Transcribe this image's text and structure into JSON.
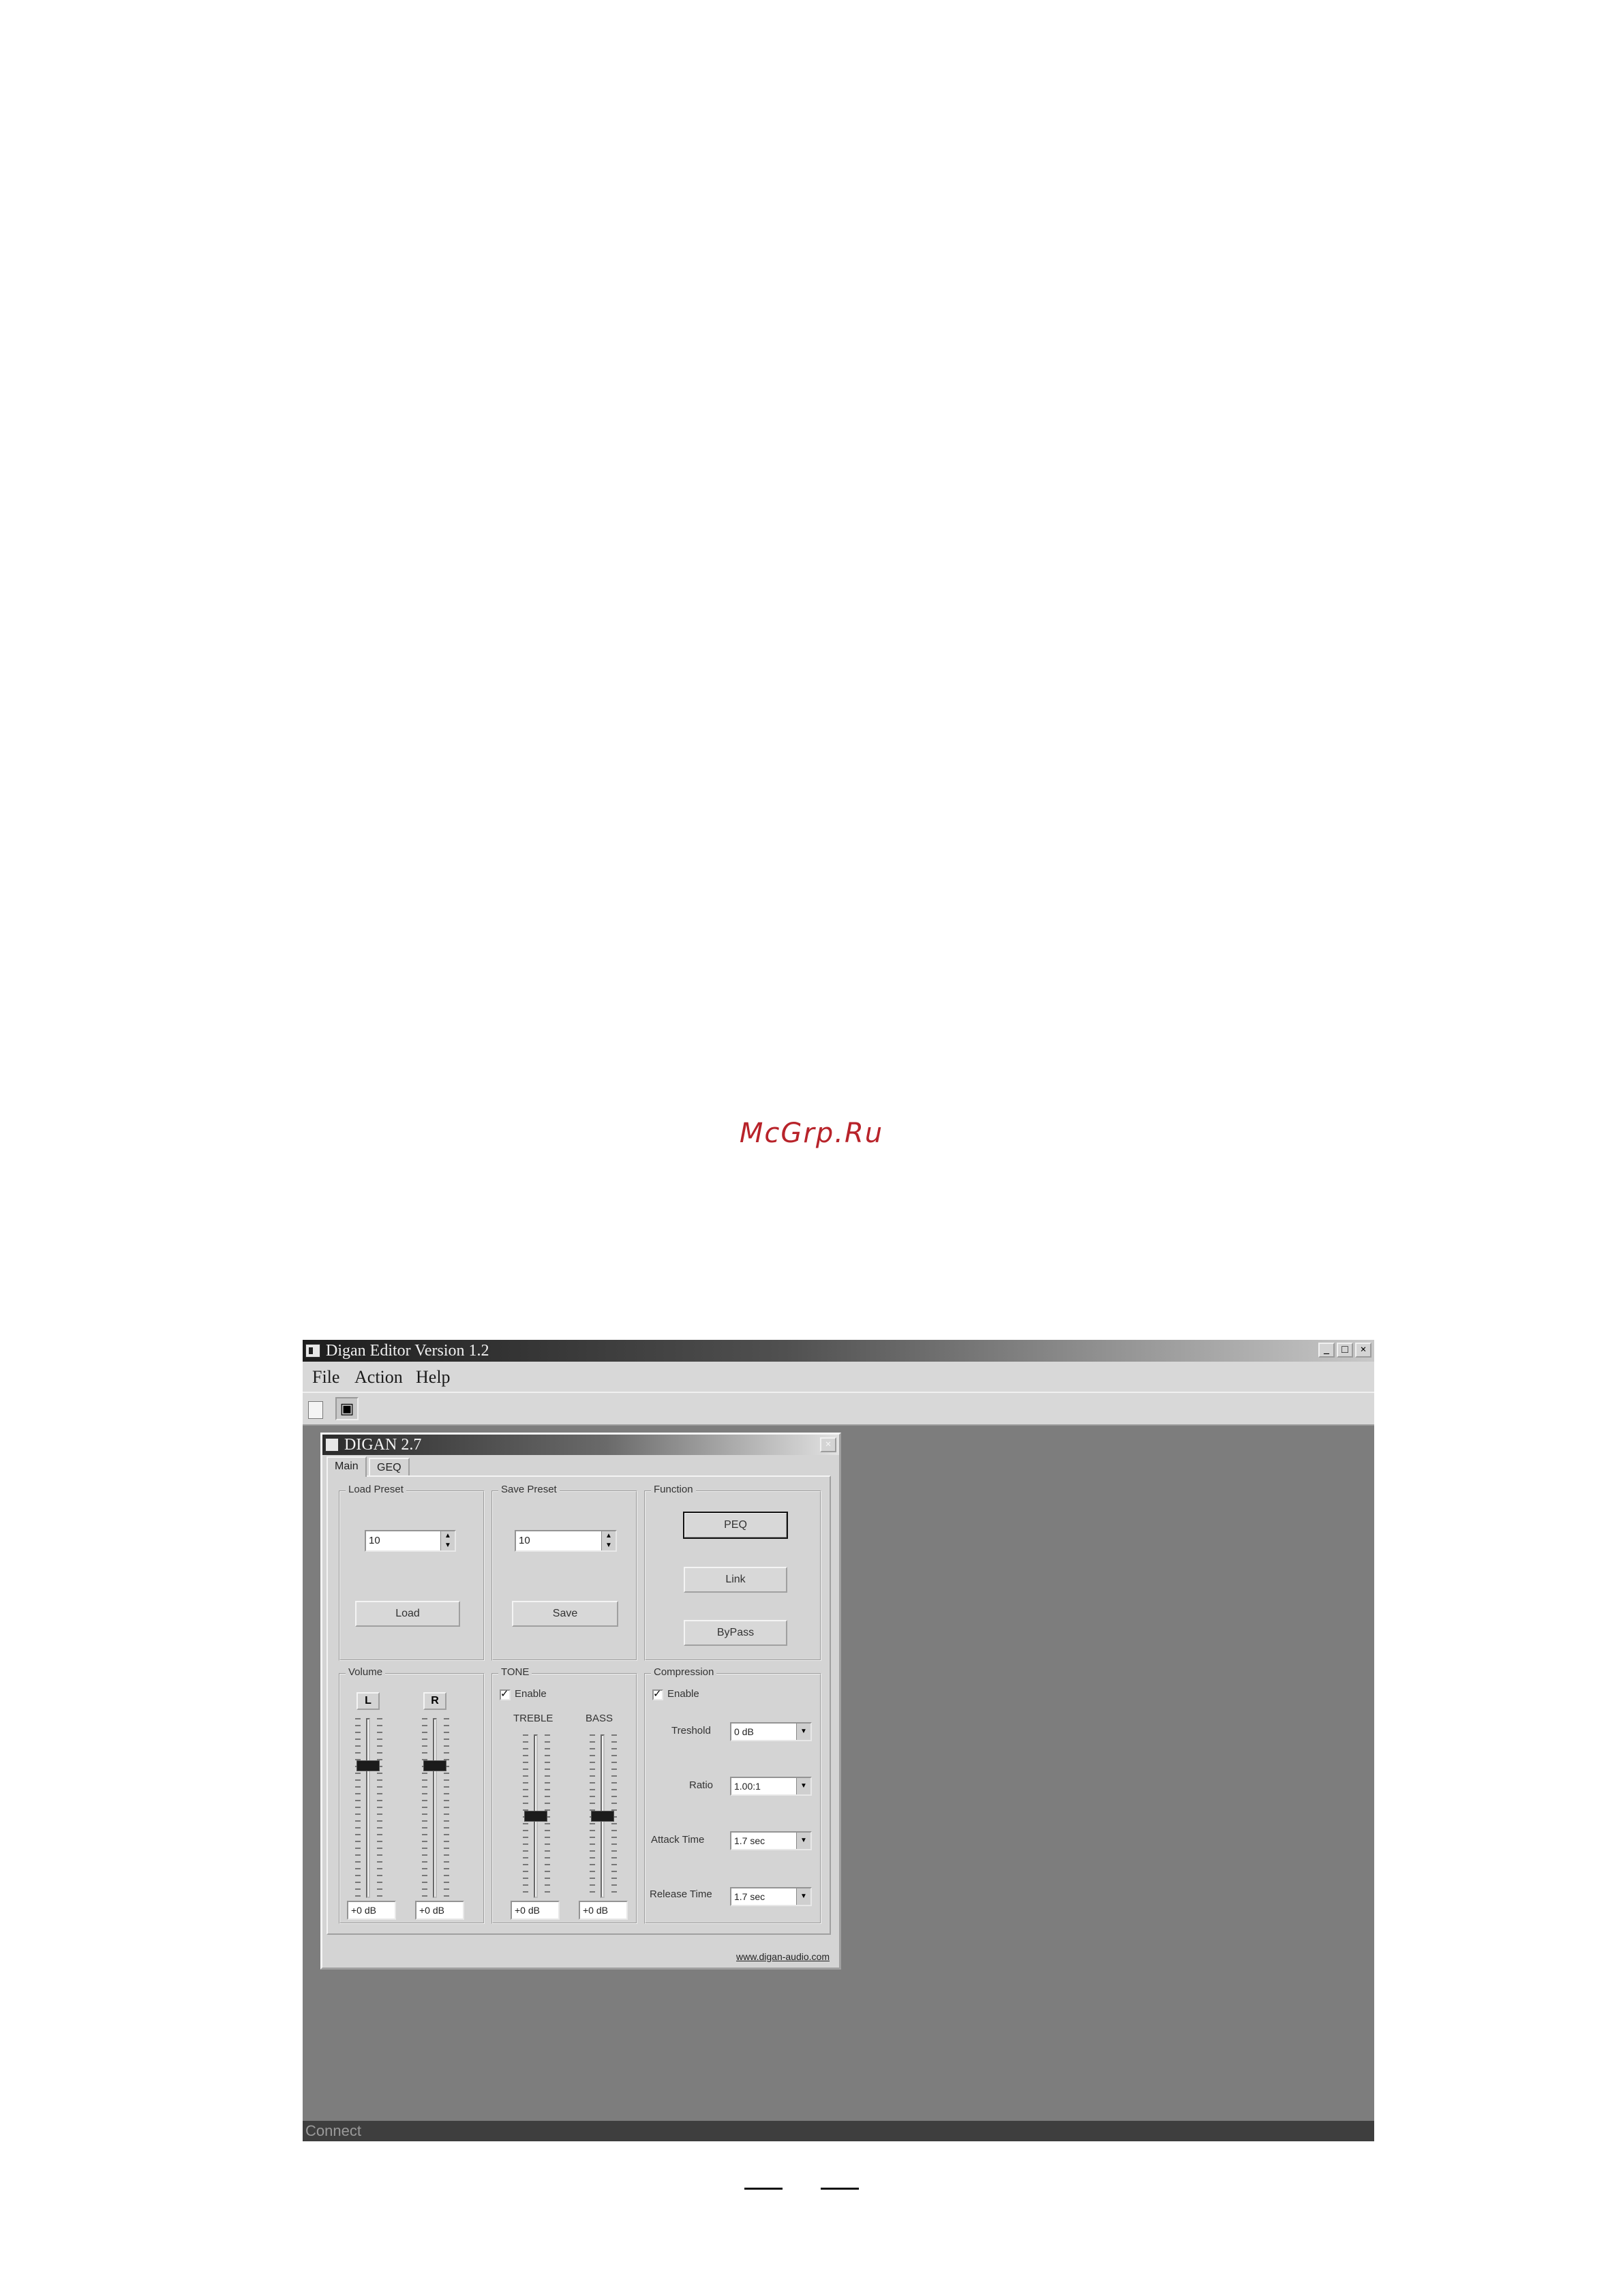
{
  "watermark": "McGrp.Ru",
  "app": {
    "title": "Digan Editor Version 1.2",
    "menu": [
      "File",
      "Action",
      "Help"
    ],
    "window_buttons": [
      "_",
      "□",
      "×"
    ],
    "toolbar_conn_glyph": "▣",
    "status": "Connect"
  },
  "child": {
    "title": "DIGAN 2.7",
    "close": "×",
    "tabs": [
      "Main",
      "GEQ"
    ],
    "active_tab": "Main",
    "load_preset": {
      "label": "Load Preset",
      "value": "10",
      "button": "Load"
    },
    "save_preset": {
      "label": "Save Preset",
      "value": "10",
      "button": "Save"
    },
    "function": {
      "label": "Function",
      "buttons": [
        "PEQ",
        "Link",
        "ByPass"
      ]
    },
    "volume": {
      "label": "Volume",
      "channels": [
        "L",
        "R"
      ],
      "readouts": [
        "+0 dB",
        "+0 dB"
      ],
      "levels": [
        0.75,
        0.75
      ]
    },
    "tone": {
      "label": "TONE",
      "enable_label": "Enable",
      "enabled": true,
      "treble_label": "TREBLE",
      "bass_label": "BASS",
      "readouts": [
        "+0 dB",
        "+0 dB"
      ],
      "levels": [
        0.5,
        0.5
      ]
    },
    "compression": {
      "label": "Compression",
      "enable_label": "Enable",
      "enabled": true,
      "threshold_label": "Treshold",
      "threshold_value": "0   dB",
      "ratio_label": "Ratio",
      "ratio_value": "1.00:1",
      "attack_label": "Attack Time",
      "attack_value": "1.7 sec",
      "release_label": "Release Time",
      "release_value": "1.7 sec"
    },
    "link": "www.digan-audio.com"
  },
  "icons": {
    "spin_up": "▲",
    "spin_down": "▼",
    "combo_drop": "▼"
  }
}
